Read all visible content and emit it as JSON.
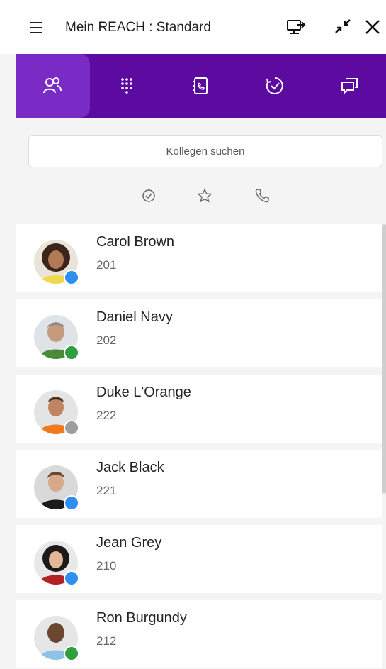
{
  "header": {
    "title": "Mein REACH : Standard",
    "icons": [
      "menu-icon",
      "screen-share-icon",
      "collapse-icon",
      "close-icon"
    ]
  },
  "nav": {
    "tabs": [
      {
        "name": "contacts",
        "icon": "contacts-icon",
        "active": true
      },
      {
        "name": "dialpad",
        "icon": "dialpad-icon",
        "active": false
      },
      {
        "name": "phonebook",
        "icon": "phonebook-icon",
        "active": false
      },
      {
        "name": "history",
        "icon": "history-icon",
        "active": false
      },
      {
        "name": "messages",
        "icon": "messages-icon",
        "active": false
      }
    ]
  },
  "search": {
    "placeholder": "Kollegen suchen",
    "value": ""
  },
  "filters": [
    "check-circle-icon",
    "star-icon",
    "phone-icon"
  ],
  "colleagues": [
    {
      "name": "Carol Brown",
      "ext": "201",
      "status": "away"
    },
    {
      "name": "Daniel Navy",
      "ext": "202",
      "status": "available"
    },
    {
      "name": "Duke L'Orange",
      "ext": "222",
      "status": "offline"
    },
    {
      "name": "Jack Black",
      "ext": "221",
      "status": "away"
    },
    {
      "name": "Jean Grey",
      "ext": "210",
      "status": "away"
    },
    {
      "name": "Ron Burgundy",
      "ext": "212",
      "status": "available"
    }
  ],
  "colors": {
    "nav_bg": "#5d0aa0",
    "nav_active": "#7a2bc6",
    "status_available": "#2e9e3e",
    "status_away": "#2f8ff0",
    "status_offline": "#9e9e9e"
  }
}
